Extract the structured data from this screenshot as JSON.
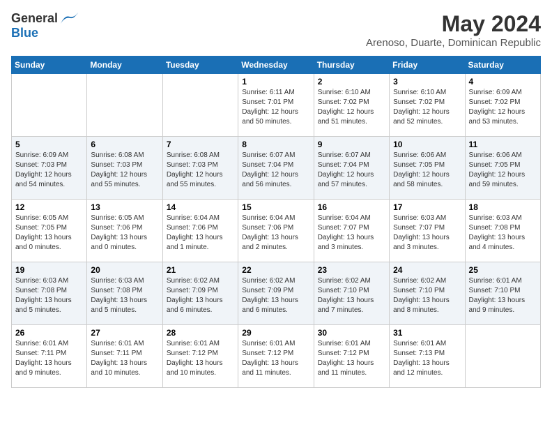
{
  "header": {
    "logo_line1": "General",
    "logo_line2": "Blue",
    "month_title": "May 2024",
    "location": "Arenoso, Duarte, Dominican Republic"
  },
  "weekdays": [
    "Sunday",
    "Monday",
    "Tuesday",
    "Wednesday",
    "Thursday",
    "Friday",
    "Saturday"
  ],
  "weeks": [
    [
      {
        "day": "",
        "sunrise": "",
        "sunset": "",
        "daylight": ""
      },
      {
        "day": "",
        "sunrise": "",
        "sunset": "",
        "daylight": ""
      },
      {
        "day": "",
        "sunrise": "",
        "sunset": "",
        "daylight": ""
      },
      {
        "day": "1",
        "sunrise": "Sunrise: 6:11 AM",
        "sunset": "Sunset: 7:01 PM",
        "daylight": "Daylight: 12 hours and 50 minutes."
      },
      {
        "day": "2",
        "sunrise": "Sunrise: 6:10 AM",
        "sunset": "Sunset: 7:02 PM",
        "daylight": "Daylight: 12 hours and 51 minutes."
      },
      {
        "day": "3",
        "sunrise": "Sunrise: 6:10 AM",
        "sunset": "Sunset: 7:02 PM",
        "daylight": "Daylight: 12 hours and 52 minutes."
      },
      {
        "day": "4",
        "sunrise": "Sunrise: 6:09 AM",
        "sunset": "Sunset: 7:02 PM",
        "daylight": "Daylight: 12 hours and 53 minutes."
      }
    ],
    [
      {
        "day": "5",
        "sunrise": "Sunrise: 6:09 AM",
        "sunset": "Sunset: 7:03 PM",
        "daylight": "Daylight: 12 hours and 54 minutes."
      },
      {
        "day": "6",
        "sunrise": "Sunrise: 6:08 AM",
        "sunset": "Sunset: 7:03 PM",
        "daylight": "Daylight: 12 hours and 55 minutes."
      },
      {
        "day": "7",
        "sunrise": "Sunrise: 6:08 AM",
        "sunset": "Sunset: 7:03 PM",
        "daylight": "Daylight: 12 hours and 55 minutes."
      },
      {
        "day": "8",
        "sunrise": "Sunrise: 6:07 AM",
        "sunset": "Sunset: 7:04 PM",
        "daylight": "Daylight: 12 hours and 56 minutes."
      },
      {
        "day": "9",
        "sunrise": "Sunrise: 6:07 AM",
        "sunset": "Sunset: 7:04 PM",
        "daylight": "Daylight: 12 hours and 57 minutes."
      },
      {
        "day": "10",
        "sunrise": "Sunrise: 6:06 AM",
        "sunset": "Sunset: 7:05 PM",
        "daylight": "Daylight: 12 hours and 58 minutes."
      },
      {
        "day": "11",
        "sunrise": "Sunrise: 6:06 AM",
        "sunset": "Sunset: 7:05 PM",
        "daylight": "Daylight: 12 hours and 59 minutes."
      }
    ],
    [
      {
        "day": "12",
        "sunrise": "Sunrise: 6:05 AM",
        "sunset": "Sunset: 7:05 PM",
        "daylight": "Daylight: 13 hours and 0 minutes."
      },
      {
        "day": "13",
        "sunrise": "Sunrise: 6:05 AM",
        "sunset": "Sunset: 7:06 PM",
        "daylight": "Daylight: 13 hours and 0 minutes."
      },
      {
        "day": "14",
        "sunrise": "Sunrise: 6:04 AM",
        "sunset": "Sunset: 7:06 PM",
        "daylight": "Daylight: 13 hours and 1 minute."
      },
      {
        "day": "15",
        "sunrise": "Sunrise: 6:04 AM",
        "sunset": "Sunset: 7:06 PM",
        "daylight": "Daylight: 13 hours and 2 minutes."
      },
      {
        "day": "16",
        "sunrise": "Sunrise: 6:04 AM",
        "sunset": "Sunset: 7:07 PM",
        "daylight": "Daylight: 13 hours and 3 minutes."
      },
      {
        "day": "17",
        "sunrise": "Sunrise: 6:03 AM",
        "sunset": "Sunset: 7:07 PM",
        "daylight": "Daylight: 13 hours and 3 minutes."
      },
      {
        "day": "18",
        "sunrise": "Sunrise: 6:03 AM",
        "sunset": "Sunset: 7:08 PM",
        "daylight": "Daylight: 13 hours and 4 minutes."
      }
    ],
    [
      {
        "day": "19",
        "sunrise": "Sunrise: 6:03 AM",
        "sunset": "Sunset: 7:08 PM",
        "daylight": "Daylight: 13 hours and 5 minutes."
      },
      {
        "day": "20",
        "sunrise": "Sunrise: 6:03 AM",
        "sunset": "Sunset: 7:08 PM",
        "daylight": "Daylight: 13 hours and 5 minutes."
      },
      {
        "day": "21",
        "sunrise": "Sunrise: 6:02 AM",
        "sunset": "Sunset: 7:09 PM",
        "daylight": "Daylight: 13 hours and 6 minutes."
      },
      {
        "day": "22",
        "sunrise": "Sunrise: 6:02 AM",
        "sunset": "Sunset: 7:09 PM",
        "daylight": "Daylight: 13 hours and 6 minutes."
      },
      {
        "day": "23",
        "sunrise": "Sunrise: 6:02 AM",
        "sunset": "Sunset: 7:10 PM",
        "daylight": "Daylight: 13 hours and 7 minutes."
      },
      {
        "day": "24",
        "sunrise": "Sunrise: 6:02 AM",
        "sunset": "Sunset: 7:10 PM",
        "daylight": "Daylight: 13 hours and 8 minutes."
      },
      {
        "day": "25",
        "sunrise": "Sunrise: 6:01 AM",
        "sunset": "Sunset: 7:10 PM",
        "daylight": "Daylight: 13 hours and 9 minutes."
      }
    ],
    [
      {
        "day": "26",
        "sunrise": "Sunrise: 6:01 AM",
        "sunset": "Sunset: 7:11 PM",
        "daylight": "Daylight: 13 hours and 9 minutes."
      },
      {
        "day": "27",
        "sunrise": "Sunrise: 6:01 AM",
        "sunset": "Sunset: 7:11 PM",
        "daylight": "Daylight: 13 hours and 10 minutes."
      },
      {
        "day": "28",
        "sunrise": "Sunrise: 6:01 AM",
        "sunset": "Sunset: 7:12 PM",
        "daylight": "Daylight: 13 hours and 10 minutes."
      },
      {
        "day": "29",
        "sunrise": "Sunrise: 6:01 AM",
        "sunset": "Sunset: 7:12 PM",
        "daylight": "Daylight: 13 hours and 11 minutes."
      },
      {
        "day": "30",
        "sunrise": "Sunrise: 6:01 AM",
        "sunset": "Sunset: 7:12 PM",
        "daylight": "Daylight: 13 hours and 11 minutes."
      },
      {
        "day": "31",
        "sunrise": "Sunrise: 6:01 AM",
        "sunset": "Sunset: 7:13 PM",
        "daylight": "Daylight: 13 hours and 12 minutes."
      },
      {
        "day": "",
        "sunrise": "",
        "sunset": "",
        "daylight": ""
      }
    ]
  ]
}
